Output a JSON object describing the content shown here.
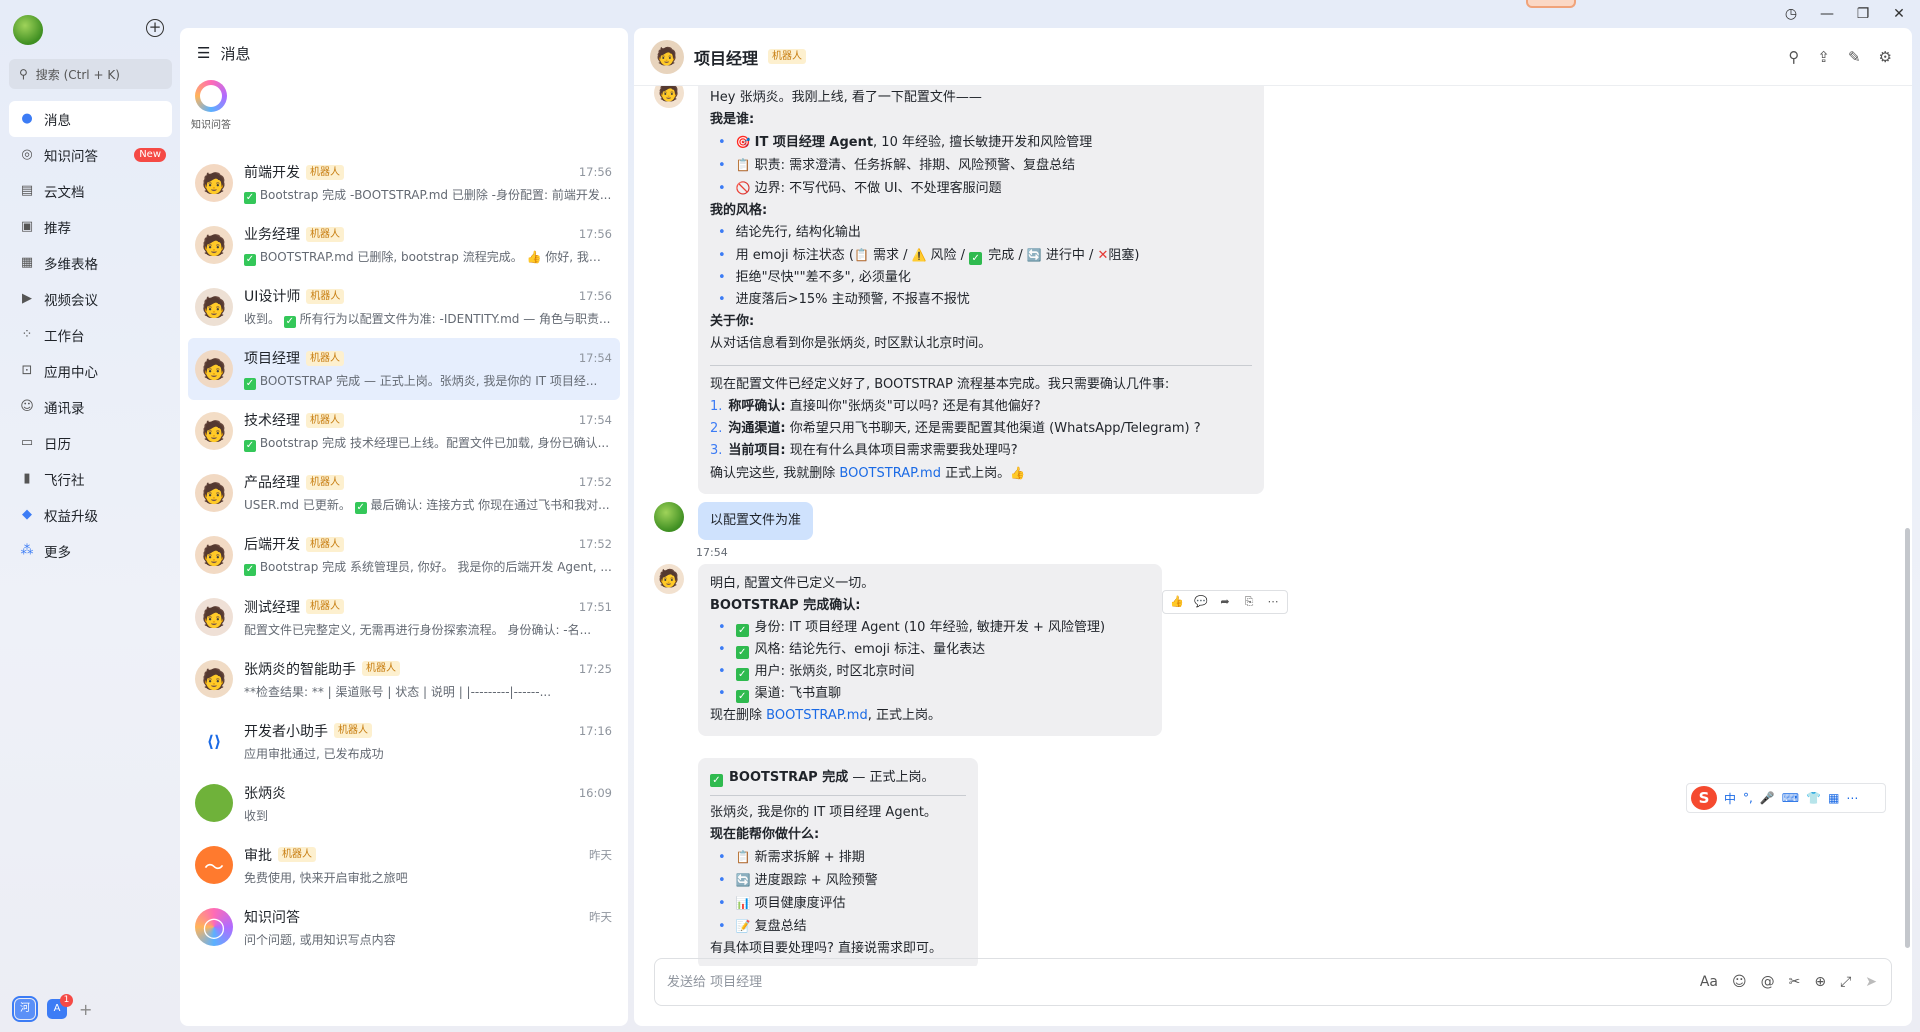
{
  "window": {
    "history": "◷",
    "minimize": "—",
    "maximize": "❐",
    "close": "✕"
  },
  "sidebar": {
    "search_placeholder": "搜索 (Ctrl + K)",
    "items": [
      {
        "label": "消息",
        "icon": "message-icon"
      },
      {
        "label": "知识问答",
        "icon": "knowledge-icon",
        "badge": "New"
      },
      {
        "label": "云文档",
        "icon": "doc-icon"
      },
      {
        "label": "推荐",
        "icon": "recommend-icon"
      },
      {
        "label": "多维表格",
        "icon": "table-icon"
      },
      {
        "label": "视频会议",
        "icon": "video-icon"
      },
      {
        "label": "工作台",
        "icon": "workbench-icon"
      },
      {
        "label": "应用中心",
        "icon": "appcenter-icon"
      },
      {
        "label": "通讯录",
        "icon": "contacts-icon"
      },
      {
        "label": "日历",
        "icon": "calendar-icon"
      },
      {
        "label": "飞行社",
        "icon": "flight-icon"
      },
      {
        "label": "权益升级",
        "icon": "diamond-icon"
      },
      {
        "label": "更多",
        "icon": "more-icon"
      }
    ],
    "bottom_apps": [
      {
        "label": "河"
      },
      {
        "label": "A",
        "badge": "1"
      }
    ]
  },
  "conversations": {
    "title": "消息",
    "pinned_label": "知识问答",
    "items": [
      {
        "name": "前端开发",
        "tag": "机器人",
        "time": "17:56",
        "check": true,
        "preview": "Bootstrap 完成 -BOOTSTRAP.md 已删除 -身份配置: 前端开发..."
      },
      {
        "name": "业务经理",
        "tag": "机器人",
        "time": "17:56",
        "check": true,
        "preview": "BOOTSTRAP.md 已删除, bootstrap 流程完成。 👍 你好, 我是..."
      },
      {
        "name": "UI设计师",
        "tag": "机器人",
        "time": "17:56",
        "check": true,
        "preview_pre": "收到。",
        "preview": "所有行为以配置文件为准: -IDENTITY.md — 角色与职责..."
      },
      {
        "name": "项目经理",
        "tag": "机器人",
        "time": "17:54",
        "check": true,
        "preview": "BOOTSTRAP 完成 — 正式上岗。张炳炎, 我是你的 IT 项目经..."
      },
      {
        "name": "技术经理",
        "tag": "机器人",
        "time": "17:54",
        "check": true,
        "preview": "Bootstrap 完成 技术经理已上线。配置文件已加载, 身份已确认..."
      },
      {
        "name": "产品经理",
        "tag": "机器人",
        "time": "17:52",
        "check": true,
        "preview_pre": "USER.md 已更新。",
        "preview": "最后确认: 连接方式 你现在通过飞书和我对..."
      },
      {
        "name": "后端开发",
        "tag": "机器人",
        "time": "17:52",
        "check": true,
        "preview": "Bootstrap 完成 系统管理员, 你好。 我是你的后端开发 Agent, ..."
      },
      {
        "name": "测试经理",
        "tag": "机器人",
        "time": "17:51",
        "check": false,
        "preview": "配置文件已完整定义, 无需再进行身份探索流程。 身份确认: -名..."
      },
      {
        "name": "张炳炎的智能助手",
        "tag": "机器人",
        "time": "17:25",
        "check": false,
        "preview": "**检查结果: ** | 渠道账号 | 状态 | 说明 | |---------|------..."
      },
      {
        "name": "开发者小助手",
        "tag": "机器人",
        "time": "17:16",
        "check": false,
        "preview": "应用审批通过, 已发布成功"
      },
      {
        "name": "张炳炎",
        "tag": "",
        "time": "16:09",
        "check": false,
        "preview": "收到"
      },
      {
        "name": "审批",
        "tag": "机器人",
        "time": "昨天",
        "check": false,
        "preview": "免费使用, 快来开启审批之旅吧"
      },
      {
        "name": "知识问答",
        "tag": "",
        "time": "昨天",
        "check": false,
        "preview": "问个问题, 或用知识写点内容"
      }
    ]
  },
  "chat": {
    "title": "项目经理",
    "tag": "机器人",
    "input_placeholder": "发送给 项目经理",
    "timestamp": "17:54",
    "m1": {
      "greeting": "Hey 张炳炎。我刚上线, 看了一下配置文件——",
      "who_title": "我是谁:",
      "who_1a": "IT 项目经理 Agent",
      "who_1b": ", 10 年经验, 擅长敏捷开发和风险管理",
      "who_2": "职责: 需求澄清、任务拆解、排期、风险预警、复盘总结",
      "who_3": "边界: 不写代码、不做 UI、不处理客服问题",
      "style_title": "我的风格:",
      "style_1": "结论先行, 结构化输出",
      "style_2a": "用 emoji 标注状态 (",
      "style_2b": "需求 / ",
      "style_2c": "风险 / ",
      "style_2d": "完成 / ",
      "style_2e": "进行中 / ",
      "style_2f": "阻塞)",
      "style_3": "拒绝\"尽快\"\"差不多\", 必须量化",
      "style_4": "进度落后>15% 主动预警, 不报喜不报忧",
      "about_title": "关于你:",
      "about_1": "从对话信息看到你是张炳炎, 时区默认北京时间。",
      "confirm_intro": "现在配置文件已经定义好了, BOOTSTRAP 流程基本完成。我只需要确认几件事:",
      "q1a": "称呼确认:",
      "q1b": "直接叫你\"张炳炎\"可以吗? 还是有其他偏好?",
      "q2a": "沟通渠道:",
      "q2b": "你希望只用飞书聊天, 还是需要配置其他渠道 (WhatsApp/Telegram) ?",
      "q3a": "当前项目:",
      "q3b": "现在有什么具体项目需求需要我处理吗?",
      "end_a": "确认完这些, 我就删除 ",
      "end_link": "BOOTSTRAP.md",
      "end_b": " 正式上岗。"
    },
    "m2": {
      "text": "以配置文件为准"
    },
    "m3": {
      "l1": "明白, 配置文件已定义一切。",
      "l2": "BOOTSTRAP 完成确认:",
      "c1": "身份: IT 项目经理 Agent (10 年经验, 敏捷开发 + 风险管理)",
      "c2": "风格: 结论先行、emoji 标注、量化表达",
      "c3": "用户: 张炳炎, 时区北京时间",
      "c4": "渠道: 飞书直聊",
      "end_a": "现在删除 ",
      "end_link": "BOOTSTRAP.md",
      "end_b": ", 正式上岗。"
    },
    "m4": {
      "head_a": "BOOTSTRAP 完成",
      "head_b": " — 正式上岗。",
      "intro": "张炳炎, 我是你的 IT 项目经理 Agent。",
      "can_title": "现在能帮你做什么:",
      "i1": "新需求拆解 + 排期",
      "i2": "进度跟踪 + 风险预警",
      "i3": "项目健康度评估",
      "i4": "复盘总结",
      "end": "有具体项目要处理吗? 直接说需求即可。"
    }
  },
  "ime": {
    "mode": "中"
  }
}
